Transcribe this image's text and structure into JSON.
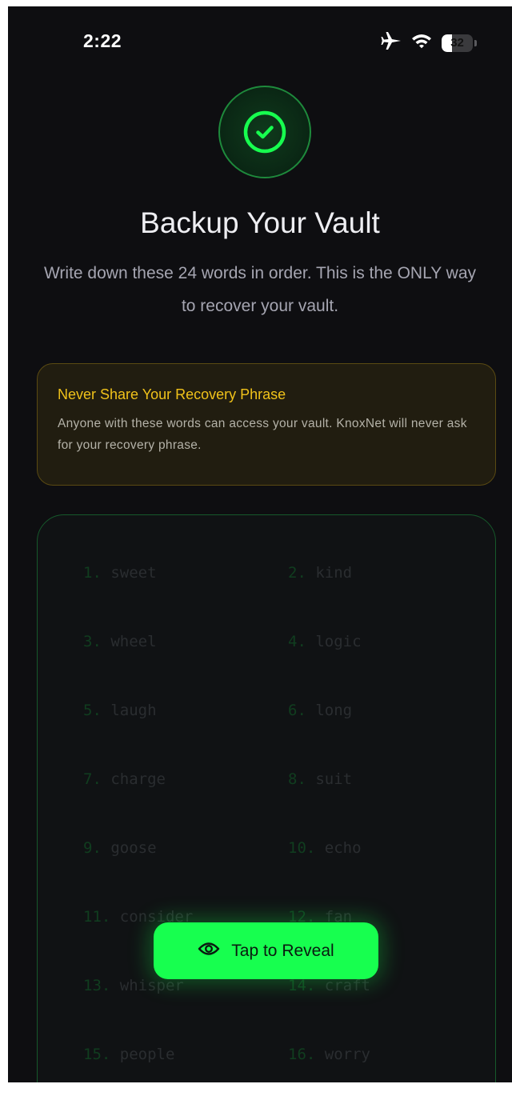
{
  "status_bar": {
    "time": "2:22",
    "battery_level": "32",
    "battery_fraction": 0.32,
    "icons": [
      "airplane-icon",
      "wifi-icon",
      "battery-icon"
    ]
  },
  "header": {
    "icon": "check-circle-icon",
    "title": "Backup Your Vault",
    "subtitle": "Write down these 24 words in order. This is the ONLY way to recover your vault."
  },
  "warning": {
    "title": "Never Share Your Recovery Phrase",
    "body": "Anyone with these words can access your vault. KnoxNet will never ask for your recovery phrase."
  },
  "phrase": {
    "words": [
      {
        "num": "1.",
        "word": "sweet"
      },
      {
        "num": "2.",
        "word": "kind"
      },
      {
        "num": "3.",
        "word": "wheel"
      },
      {
        "num": "4.",
        "word": "logic"
      },
      {
        "num": "5.",
        "word": "laugh"
      },
      {
        "num": "6.",
        "word": "long"
      },
      {
        "num": "7.",
        "word": "charge"
      },
      {
        "num": "8.",
        "word": "suit"
      },
      {
        "num": "9.",
        "word": "goose"
      },
      {
        "num": "10.",
        "word": "echo"
      },
      {
        "num": "11.",
        "word": "consider"
      },
      {
        "num": "12.",
        "word": "fan"
      },
      {
        "num": "13.",
        "word": "whisper"
      },
      {
        "num": "14.",
        "word": "craft"
      },
      {
        "num": "15.",
        "word": "people"
      },
      {
        "num": "16.",
        "word": "worry"
      }
    ]
  },
  "reveal": {
    "icon": "eye-icon",
    "label": "Tap to Reveal"
  },
  "colors": {
    "accent": "#17ff4f",
    "warning": "#f0c21a",
    "background": "#0e0e11"
  }
}
